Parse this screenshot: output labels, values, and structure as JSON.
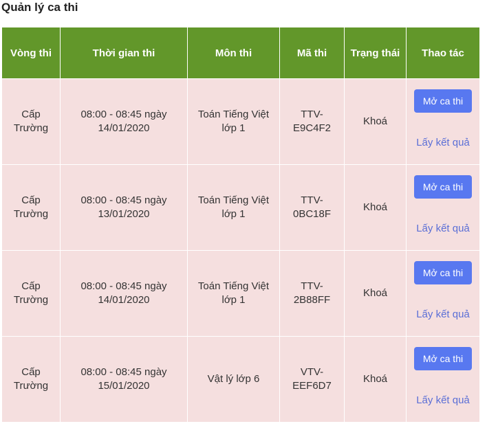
{
  "page": {
    "title": "Quản lý ca thi"
  },
  "table": {
    "headers": [
      "Vòng thi",
      "Thời gian thi",
      "Môn thi",
      "Mã thi",
      "Trạng thái",
      "Thao tác"
    ],
    "rows": [
      {
        "round": "Cấp Trường",
        "time": "08:00 - 08:45 ngày 14/01/2020",
        "subject": "Toán Tiếng Việt lớp 1",
        "code": "TTV-E9C4F2",
        "status": "Khoá",
        "open_label": "Mở ca thi",
        "result_label": "Lấy kết quả"
      },
      {
        "round": "Cấp Trường",
        "time": "08:00 - 08:45 ngày 13/01/2020",
        "subject": "Toán Tiếng Việt lớp 1",
        "code": "TTV-0BC18F",
        "status": "Khoá",
        "open_label": "Mở ca thi",
        "result_label": "Lấy kết quả"
      },
      {
        "round": "Cấp Trường",
        "time": "08:00 - 08:45 ngày 14/01/2020",
        "subject": "Toán Tiếng Việt lớp 1",
        "code": "TTV-2B88FF",
        "status": "Khoá",
        "open_label": "Mở ca thi",
        "result_label": "Lấy kết quả"
      },
      {
        "round": "Cấp Trường",
        "time": "08:00 - 08:45 ngày 15/01/2020",
        "subject": "Vật lý lớp 6",
        "code": "VTV-EEF6D7",
        "status": "Khoá",
        "open_label": "Mở ca thi",
        "result_label": "Lấy kết quả"
      }
    ]
  },
  "colors": {
    "header_bg": "#62972a",
    "row_bg": "#f5dfdf",
    "button_bg": "#5878f0",
    "link": "#5b6fd6"
  }
}
